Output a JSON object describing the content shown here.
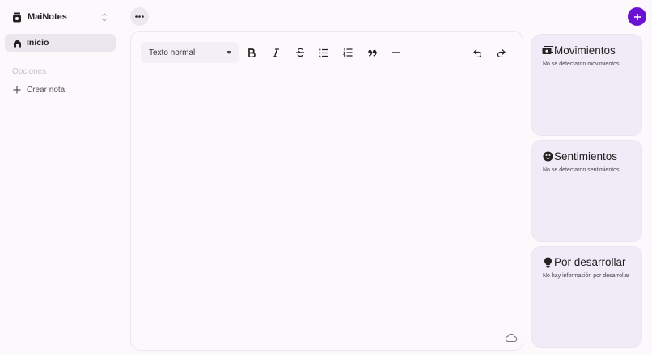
{
  "sidebar": {
    "brand": "MaiNotes",
    "nav": {
      "home_label": "Inicio"
    },
    "section_label": "Opciones",
    "create_note_label": "Crear nota"
  },
  "editor": {
    "format_select_value": "Texto normal",
    "toolbar_icons": [
      "bold-icon",
      "italic-icon",
      "strikethrough-icon",
      "bullet-list-icon",
      "numbered-list-icon",
      "quote-icon",
      "horizontal-rule-icon",
      "undo-icon",
      "redo-icon"
    ],
    "status_icon": "cloud-icon"
  },
  "panels": [
    {
      "title": "Movimientos",
      "subtitle": "No se detectaron movimientos",
      "icon": "money-icon"
    },
    {
      "title": "Sentimientos",
      "subtitle": "No se detectaron sentimientos",
      "icon": "smiley-icon"
    },
    {
      "title": "Por desarrollar",
      "subtitle": "No hay información por desarrollar",
      "icon": "lightbulb-icon"
    }
  ],
  "colors": {
    "accent": "#6a12d1",
    "panel_bg": "#f1ebf8",
    "active_nav": "#ece6ef",
    "page_bg": "#fdf8fc"
  }
}
